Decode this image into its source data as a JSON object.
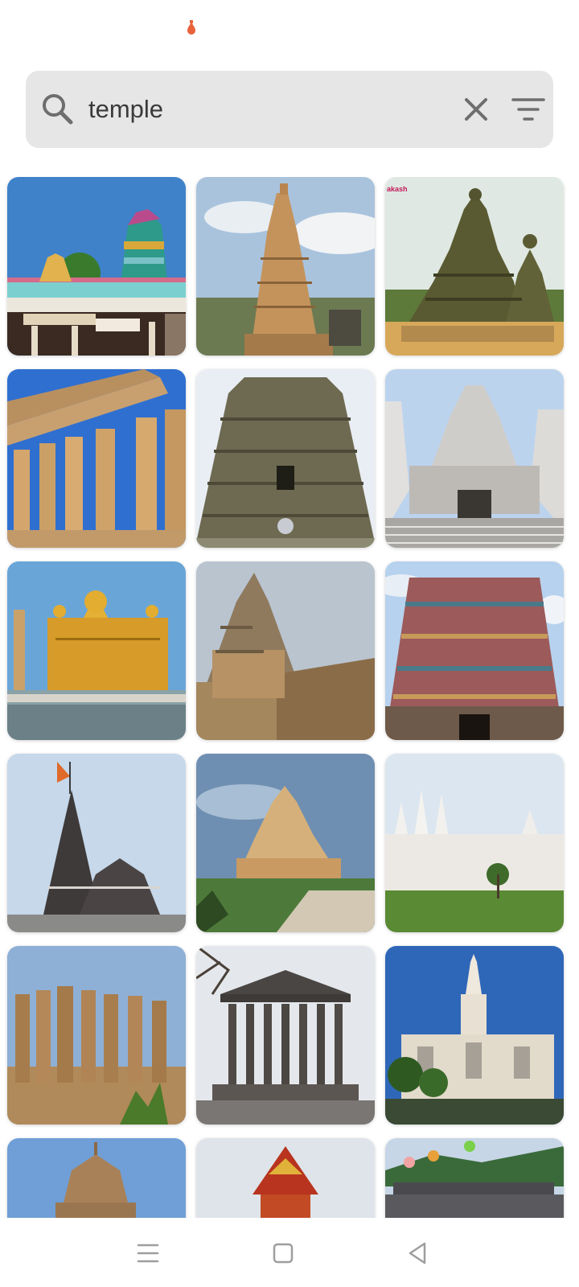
{
  "search": {
    "query": "temple",
    "icon": "search-icon",
    "clear_icon": "close-icon",
    "filter_icon": "filter-icon"
  },
  "status_bar": {
    "indicator_color": "#e8623a"
  },
  "colors": {
    "search_background": "#e6e6e6",
    "icon_gray": "#7a7a7a",
    "page_background": "#ffffff"
  },
  "results": [
    {
      "subject": "south-indian-gopuram-entrance",
      "sky": "#3f82c9"
    },
    {
      "subject": "tall-stone-gopuram-tower",
      "sky": "#a9c3dd"
    },
    {
      "subject": "shore-temple-pyramids",
      "sky": "#dfe8e2",
      "caption": "akash"
    },
    {
      "subject": "greek-doric-temple-columns",
      "sky": "#2f6fd0"
    },
    {
      "subject": "carved-gopuram-tower",
      "sky": "#e9eef4"
    },
    {
      "subject": "white-marble-temple-facade",
      "sky": "#bcd3ee"
    },
    {
      "subject": "golden-temple",
      "sky": "#6aa5d8"
    },
    {
      "subject": "brihadeeswarar-vimana",
      "sky": "#b9c4cf"
    },
    {
      "subject": "colorful-gopuram-tower",
      "sky": "#b7d2ee"
    },
    {
      "subject": "dwarka-shikhara-with-flag",
      "sky": "#c6d8ea"
    },
    {
      "subject": "somnath-temple-garden",
      "sky": "#6f8fb2"
    },
    {
      "subject": "white-marble-temple-lawn",
      "sky": "#dce6f0"
    },
    {
      "subject": "egyptian-temple-columns",
      "sky": "#8eb0d6"
    },
    {
      "subject": "garni-greek-temple",
      "sky": "#e4e8ec"
    },
    {
      "subject": "white-spire-temple",
      "sky": "#2f67b8"
    },
    {
      "subject": "stone-dome-temple-partial",
      "sky": "#6f9fd6"
    },
    {
      "subject": "thai-red-roof-temple-partial",
      "sky": "#dfe4ea"
    },
    {
      "subject": "pagoda-with-lanterns-partial",
      "sky": "#c6d6e6"
    }
  ],
  "nav": {
    "menu_icon": "menu-icon",
    "home_icon": "home-square-icon",
    "back_icon": "back-triangle-icon"
  }
}
